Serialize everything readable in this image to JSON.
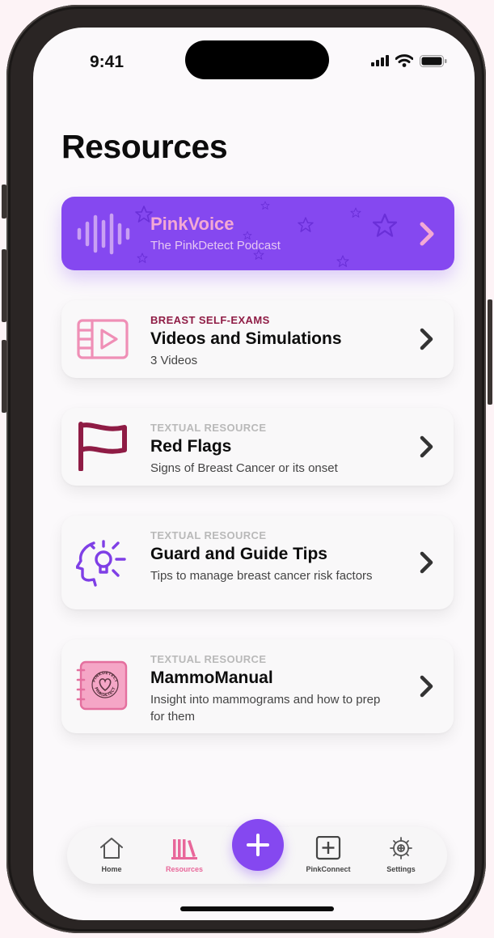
{
  "status_bar": {
    "time": "9:41"
  },
  "page": {
    "title": "Resources"
  },
  "podcast": {
    "title": "PinkVoice",
    "subtitle": "The PinkDetect Podcast"
  },
  "cards": [
    {
      "kicker": "BREAST SELF-EXAMS",
      "title": "Videos and Simulations",
      "subtitle": "3 Videos"
    },
    {
      "kicker": "TEXTUAL RESOURCE",
      "title": "Red Flags",
      "subtitle": "Signs of Breast Cancer or its onset"
    },
    {
      "kicker": "TEXTUAL RESOURCE",
      "title": "Guard and Guide Tips",
      "subtitle": "Tips to manage breast cancer risk factors"
    },
    {
      "kicker": "TEXTUAL RESOURCE",
      "title": "MammoManual",
      "subtitle": "Insight into mammograms and how to prep for them"
    }
  ],
  "book_badge": {
    "top": "PINKDETECT",
    "bottom": "PINKDETECT"
  },
  "tab_bar": {
    "home": "Home",
    "resources": "Resources",
    "pinkconnect": "PinkConnect",
    "settings": "Settings",
    "active": "Resources"
  },
  "colors": {
    "podcast_bg": "#8548f0",
    "podcast_title": "#f3a9d4",
    "kicker_highlight": "#8f1c45",
    "kicker_muted": "#b9b9b9",
    "icon_pink": "#ef8fb6",
    "flag_maroon": "#8f1c45",
    "bulb_purple": "#7f3fe6",
    "tab_active": "#e8679a"
  }
}
